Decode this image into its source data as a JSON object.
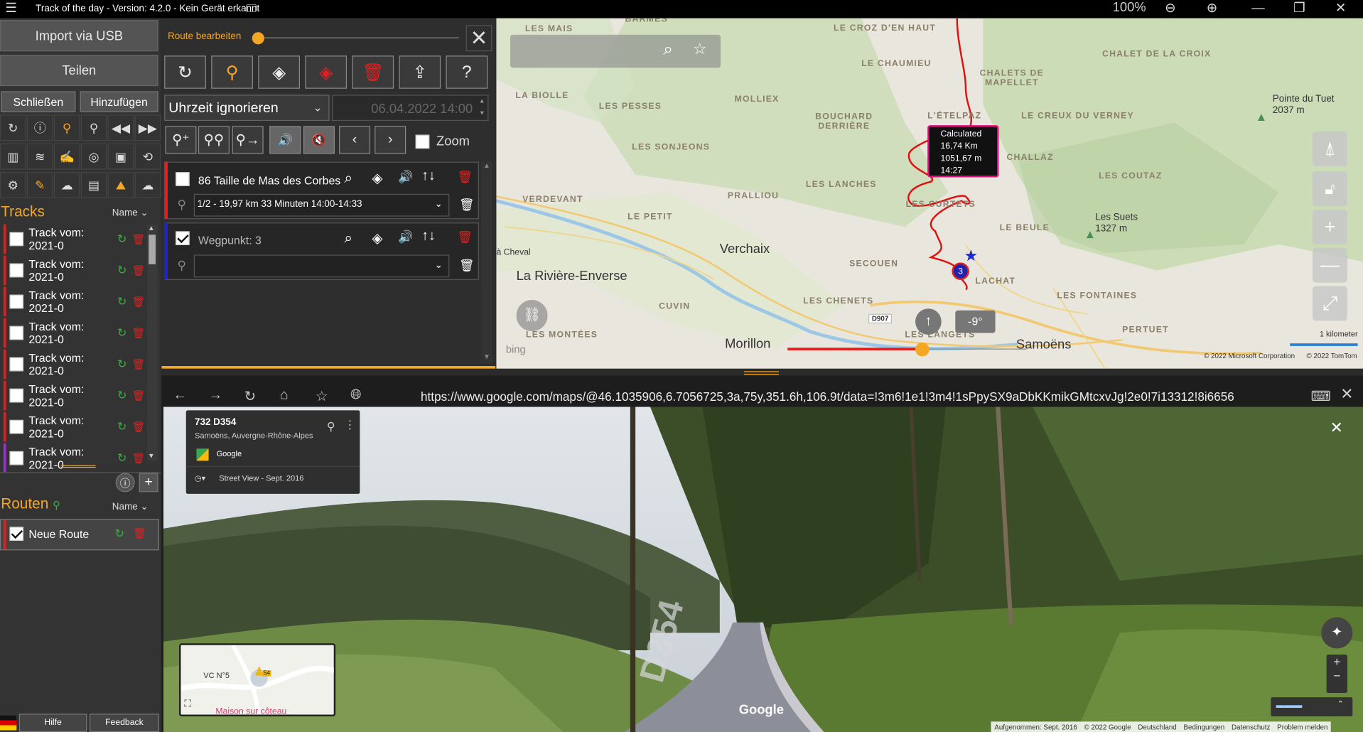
{
  "titlebar": {
    "title": "Track of the day - Version: 4.2.0 - Kein Gerät erkannt",
    "zoom": "100%"
  },
  "left": {
    "import_label": "Import via USB",
    "share_label": "Teilen",
    "close_label": "Schließen",
    "add_label": "Hinzufügen",
    "tracks_title": "Tracks",
    "sort_label": "Name",
    "tracks": [
      {
        "label": "Track vom: 2021-0"
      },
      {
        "label": "Track vom: 2021-0"
      },
      {
        "label": "Track vom: 2021-0"
      },
      {
        "label": "Track vom: 2021-0"
      },
      {
        "label": "Track vom: 2021-0"
      },
      {
        "label": "Track vom: 2021-0"
      },
      {
        "label": "Track vom: 2021-0"
      },
      {
        "label": "Track vom: 2021-0"
      }
    ],
    "routes_title": "Routen",
    "routes_sort_label": "Name",
    "routes": [
      {
        "label": "Neue Route"
      }
    ],
    "help_label": "Hilfe",
    "feedback_label": "Feedback"
  },
  "route_editor": {
    "title": "Route bearbeiten",
    "time_mode": "Uhrzeit ignorieren",
    "datetime": "06.04.2022 14:00",
    "zoom_label": "Zoom",
    "waypoints": [
      {
        "name": "86 Taille de Mas des Corbes",
        "detail": "1/2 - 19,97 km 33 Minuten 14:00-14:33",
        "color": "#e02020",
        "checked": false
      },
      {
        "name": "Wegpunkt: 3",
        "detail": "",
        "color": "#2222cc",
        "checked": true
      }
    ]
  },
  "map": {
    "search_placeholder": "",
    "tooltip": {
      "line1": "Calculated",
      "line2": "16,74 Km",
      "line3": "1051,67 m",
      "line4": "14:27"
    },
    "heading": "-9°",
    "scale": "1 kilometer",
    "copyright1": "© 2022 Microsoft Corporation",
    "copyright2": "© 2022 TomTom",
    "bing": "bing",
    "waypoint_number": "3",
    "road": "D907",
    "labels": {
      "les_mais": "LES MAIS",
      "barmes": "BARMES",
      "le_croz": "LE CROZ D'EN HAUT",
      "chalet_croix": "CHALET DE LA CROIX",
      "le_chaumieu": "LE CHAUMIEU",
      "chalets_mapellet": "CHALETS DE MAPELLET",
      "pointe": "Pointe du Tuet",
      "pointe_alt": "2037 m",
      "la_biolle": "LA BIOLLE",
      "les_pesses": "LES PESSES",
      "molliex": "MOLLIEX",
      "etelpaz": "L'ÉTELPAZ",
      "creux": "LE CREUX DU VERNEY",
      "bouchard": "BOUCHARD DERRIÈRE",
      "sonjeons": "LES SONJEONS",
      "challaz": "CHALLAZ",
      "lanches": "LES LANCHES",
      "coutaz": "LES COUTAZ",
      "verdevant": "VERDEVANT",
      "pralliou": "PRALLIOU",
      "curtets": "LES CURTETS",
      "suets": "Les Suets",
      "suets_alt": "1327 m",
      "le_petit": "LE PETIT",
      "le_beule": "LE BEULE",
      "verchaix": "Verchaix",
      "cheval": "à Cheval",
      "secouen": "SECOUEN",
      "riviere": "La Rivière-Enverse",
      "lachat": "LACHAT",
      "cuvin": "CUVIN",
      "chenets": "LES CHENETS",
      "fontaines": "LES FONTAINES",
      "montees": "LES MONTÉES",
      "langets": "LES LANGETS",
      "pertuet": "PERTUET",
      "morillon": "Morillon",
      "samoens": "Samoëns"
    }
  },
  "browser": {
    "url": "https://www.google.com/maps/@46.1035906,6.7056725,3a,75y,351.6h,106.9t/data=!3m6!1e1!3m4!1sPpySX9aDbKKmikGMtcxvJg!2e0!7i13312!8i6656",
    "place_title": "732 D354",
    "place_sub": "Samoëns, Auvergne-Rhône-Alpes",
    "provider": "Google",
    "sv_date": "Street View - Sept. 2016",
    "minimap_road": "VC N°5",
    "minimap_place": "Maison sur côteau",
    "minimap_badge": "54",
    "google_logo": "Google",
    "road_marking": "D354",
    "footer": [
      "Aufgenommen: Sept. 2016",
      "© 2022 Google",
      "Deutschland",
      "Bedingungen",
      "Datenschutz",
      "Problem melden"
    ]
  }
}
